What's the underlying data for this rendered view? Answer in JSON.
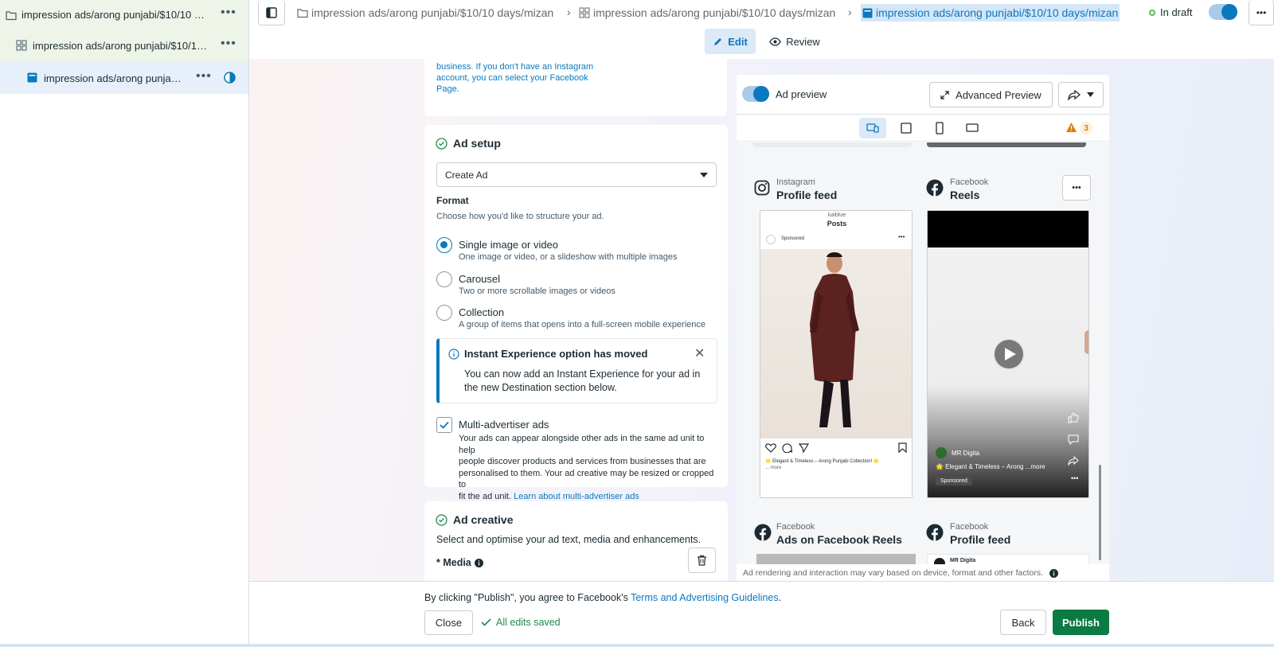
{
  "sidebar": {
    "items": [
      {
        "label": "impression ads/arong punjabi/$10/10 da...",
        "icon": "folder-icon"
      },
      {
        "label": "impression ads/arong punjabi/$10/10 ...",
        "icon": "grid-icon"
      },
      {
        "label": "impression ads/arong punjabi...",
        "icon": "ad-icon"
      }
    ]
  },
  "topbar": {
    "crumbs": [
      "impression ads/arong punjabi/$10/10 days/mizan",
      "impression ads/arong punjabi/$10/10 days/mizan",
      "impression ads/arong punjabi/$10/10 days/mizan"
    ],
    "status": "In draft",
    "modes": {
      "edit": "Edit",
      "review": "Review"
    }
  },
  "instagram_note": {
    "lines": [
      "business. If you don't have an Instagram",
      "account, you can select your Facebook",
      "Page."
    ]
  },
  "ad_setup": {
    "title": "Ad setup",
    "dropdown_value": "Create Ad",
    "format_label": "Format",
    "format_help": "Choose how you'd like to structure your ad.",
    "options": [
      {
        "title": "Single image or video",
        "sub": "One image or video, or a slideshow with multiple images",
        "selected": true
      },
      {
        "title": "Carousel",
        "sub": "Two or more scrollable images or videos",
        "selected": false
      },
      {
        "title": "Collection",
        "sub": "A group of items that opens into a full-screen mobile experience",
        "selected": false
      }
    ],
    "notice": {
      "title": "Instant Experience option has moved",
      "body_line1": "You can now add an Instant Experience for your ad in",
      "body_line2": "the new Destination section below."
    },
    "multi_advertiser": {
      "title": "Multi-advertiser ads",
      "checked": true,
      "lines": [
        "Your ads can appear alongside other ads in the same ad unit to help",
        "people discover products and services from businesses that are",
        "personalised to them. Your ad creative may be resized or cropped to"
      ],
      "last_line": "fit the ad unit.",
      "link": "Learn about multi-advertiser ads"
    }
  },
  "ad_creative": {
    "title": "Ad creative",
    "help": "Select and optimise your ad text, media and enhancements.",
    "media_label": "* Media"
  },
  "preview": {
    "toggle_label": "Ad preview",
    "advanced_label": "Advanced Preview",
    "warning_count": "3",
    "placements": [
      {
        "platform": "Instagram",
        "name": "Profile feed"
      },
      {
        "platform": "Facebook",
        "name": "Reels"
      },
      {
        "platform": "Facebook",
        "name": "Ads on Facebook Reels"
      },
      {
        "platform": "Facebook",
        "name": "Profile feed"
      }
    ],
    "ig_card": {
      "account": "kaiblue",
      "header": "Posts",
      "sponsored": "Sponsored",
      "caption": "🌟 Elegant & Timeless – Arong Punjabi Collection! 🌟",
      "more": "... more"
    },
    "reel_card": {
      "page": "MR Digita",
      "caption": "🌟 Elegant & Timeless – Arong  ...more",
      "sponsored": "Sponsored"
    },
    "partial_name": "MR Digita",
    "disclaimer": "Ad rendering and interaction may vary based on device, format and other factors."
  },
  "footer": {
    "consent_prefix": "By clicking \"Publish\", you agree to Facebook's ",
    "consent_link": "Terms and Advertising Guidelines",
    "consent_suffix": ".",
    "close": "Close",
    "saved": "All edits saved",
    "back": "Back",
    "publish": "Publish"
  },
  "colors": {
    "accent": "#0a78be",
    "publish": "#0c7a43",
    "warning": "#e07b00"
  }
}
